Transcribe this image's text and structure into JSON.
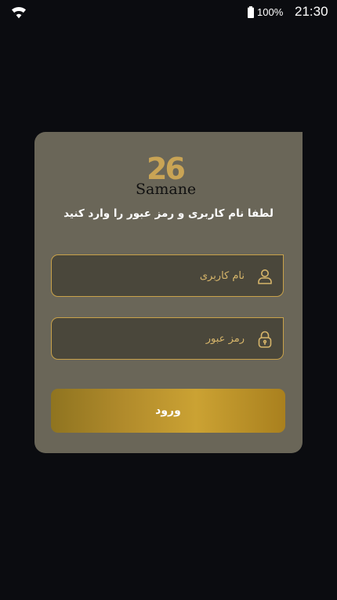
{
  "status_bar": {
    "battery": "100%",
    "time": "21:30",
    "icons": [
      "wifi-icon",
      "battery-icon"
    ]
  },
  "logo": {
    "number": "26",
    "word": "Samane"
  },
  "login": {
    "prompt": "لطفا نام کاربری و رمز عبور را وارد کنید",
    "username_placeholder": "نام کاربری",
    "username_icon": "user-icon",
    "password_placeholder": "رمز عبور",
    "password_icon": "lock-icon",
    "submit_label": "ورود"
  },
  "colors": {
    "background": "#0b0c10",
    "card": "#6a6658",
    "field": "#4a473b",
    "gold": "#c9a24a",
    "placeholder": "#d6b56a"
  }
}
